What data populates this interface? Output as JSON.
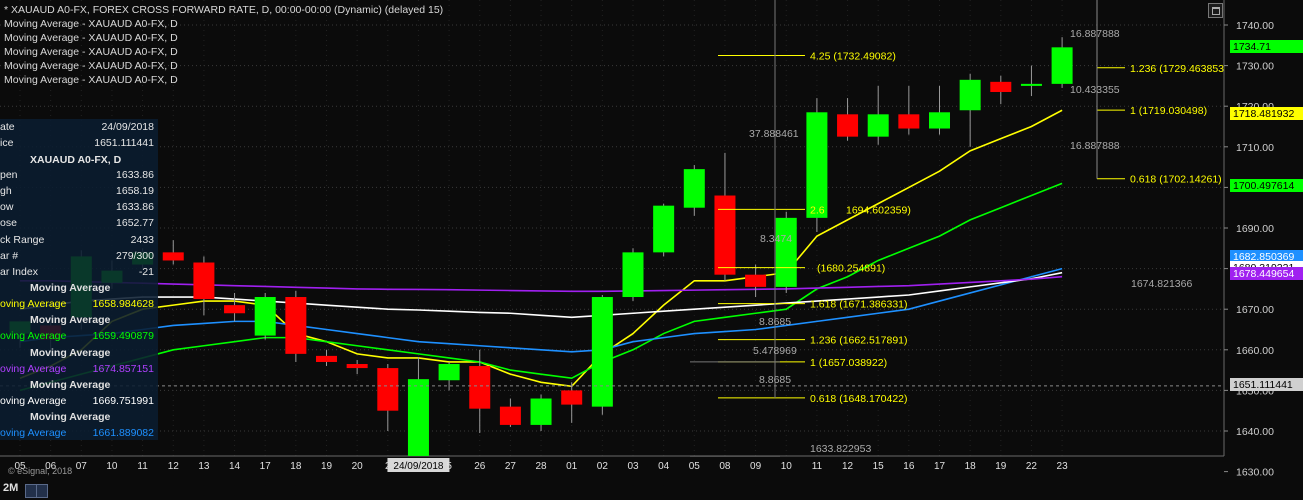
{
  "header": {
    "title": "* XAUAUD A0-FX, FOREX CROSS FORWARD RATE, D, 00:00-00:00 (Dynamic) (delayed 15)",
    "studies": [
      "Moving Average - XAUAUD A0-FX, D",
      "Moving Average - XAUAUD A0-FX, D",
      "Moving Average - XAUAUD A0-FX, D",
      "Moving Average - XAUAUD A0-FX, D",
      "Moving Average - XAUAUD A0-FX, D"
    ]
  },
  "panel": {
    "date_label": "ate",
    "date_value": "24/09/2018",
    "price_label": "ice",
    "price_value": "1651.111441",
    "symbol": "XAUAUD A0-FX, D",
    "open_label": "pen",
    "open_value": "1633.86",
    "high_label": "gh",
    "high_value": "1658.19",
    "low_label": "ow",
    "low_value": "1633.86",
    "close_label": "ose",
    "close_value": "1652.77",
    "tick_label": "ck Range",
    "tick_value": "2433",
    "bar_label": "ar #",
    "bar_value": "279/300",
    "index_label": "ar Index",
    "index_value": "-21",
    "ma": [
      {
        "head": "Moving Average",
        "label": "oving Average",
        "value": "1658.984628",
        "color": "#ffff00"
      },
      {
        "head": "Moving Average",
        "label": "oving Average",
        "value": "1659.490879",
        "color": "#00ff00"
      },
      {
        "head": "Moving Average",
        "label": "oving Average",
        "value": "1674.857151",
        "color": "#a020f0"
      },
      {
        "head": "Moving Average",
        "label": "oving Average",
        "value": "1669.751991",
        "color": "#ffffff"
      },
      {
        "head": "Moving Average",
        "label": "oving Average",
        "value": "1661.889082",
        "color": "#1e90ff"
      }
    ]
  },
  "footer": {
    "copyright": "© eSignal, 2018",
    "timeframe": "2M"
  },
  "colors": {
    "background": "#0b0b0b",
    "up": "#00ff00",
    "down": "#ff0000",
    "fib": "#ffff00",
    "grid": "#3a3a3a"
  },
  "chart_data": {
    "type": "candlestick",
    "ylim": [
      1628,
      1746
    ],
    "yticks": [
      "1740.00",
      "1730.00",
      "1720.00",
      "1710.00",
      "1700.00",
      "1690.00",
      "1680.00",
      "1670.00",
      "1660.00",
      "1650.00",
      "1640.00",
      "1630.00"
    ],
    "x": [
      "05",
      "06",
      "07",
      "10",
      "11",
      "12",
      "13",
      "14",
      "17",
      "18",
      "19",
      "20",
      "21",
      "24/09/2018",
      "25",
      "26",
      "27",
      "28",
      "01",
      "02",
      "03",
      "04",
      "05",
      "08",
      "09",
      "10",
      "11",
      "12",
      "15",
      "16",
      "17",
      "18",
      "19",
      "22",
      "23"
    ],
    "x_tick_labels": [
      "05",
      "06",
      "07",
      "10",
      "11",
      "12",
      "13",
      "14",
      "17",
      "18",
      "19",
      "20",
      "2",
      "24/09/2018",
      "5",
      "26",
      "27",
      "28",
      "01",
      "02",
      "03",
      "04",
      "05",
      "08",
      "09",
      "10",
      "11",
      "12",
      "15",
      "16",
      "17",
      "18",
      "19",
      "22",
      "23"
    ],
    "candles": [
      {
        "o": 1664.0,
        "h": 1666.5,
        "l": 1660.5,
        "c": 1667.0
      },
      {
        "o": 1666.0,
        "h": 1667.5,
        "l": 1658.5,
        "c": 1662.5
      },
      {
        "o": 1668.0,
        "h": 1684.5,
        "l": 1665.0,
        "c": 1683.0
      },
      {
        "o": 1676.5,
        "h": 1682.0,
        "l": 1675.0,
        "c": 1679.5
      },
      {
        "o": 1681.0,
        "h": 1685.0,
        "l": 1680.0,
        "c": 1684.0
      },
      {
        "o": 1684.0,
        "h": 1687.0,
        "l": 1681.0,
        "c": 1682.0
      },
      {
        "o": 1681.5,
        "h": 1683.0,
        "l": 1668.5,
        "c": 1672.5
      },
      {
        "o": 1671.0,
        "h": 1674.0,
        "l": 1667.0,
        "c": 1669.0
      },
      {
        "o": 1663.5,
        "h": 1674.0,
        "l": 1662.5,
        "c": 1673.0
      },
      {
        "o": 1673.0,
        "h": 1674.5,
        "l": 1657.0,
        "c": 1659.0
      },
      {
        "o": 1658.5,
        "h": 1660.0,
        "l": 1656.0,
        "c": 1657.0
      },
      {
        "o": 1656.5,
        "h": 1657.5,
        "l": 1654.0,
        "c": 1655.5
      },
      {
        "o": 1655.5,
        "h": 1656.5,
        "l": 1640.0,
        "c": 1645.0
      },
      {
        "o": 1633.86,
        "h": 1658.19,
        "l": 1633.86,
        "c": 1652.77
      },
      {
        "o": 1652.5,
        "h": 1657.0,
        "l": 1650.0,
        "c": 1656.5
      },
      {
        "o": 1656.0,
        "h": 1660.0,
        "l": 1639.5,
        "c": 1645.5
      },
      {
        "o": 1646.0,
        "h": 1648.0,
        "l": 1641.0,
        "c": 1641.5
      },
      {
        "o": 1641.5,
        "h": 1649.0,
        "l": 1640.0,
        "c": 1648.0
      },
      {
        "o": 1650.0,
        "h": 1652.0,
        "l": 1642.0,
        "c": 1646.5
      },
      {
        "o": 1646.0,
        "h": 1673.5,
        "l": 1644.0,
        "c": 1673.0
      },
      {
        "o": 1673.0,
        "h": 1685.0,
        "l": 1672.0,
        "c": 1684.0
      },
      {
        "o": 1684.0,
        "h": 1696.0,
        "l": 1683.0,
        "c": 1695.5
      },
      {
        "o": 1695.0,
        "h": 1705.5,
        "l": 1693.0,
        "c": 1704.5
      },
      {
        "o": 1698.0,
        "h": 1708.5,
        "l": 1677.0,
        "c": 1678.5
      },
      {
        "o": 1678.5,
        "h": 1681.0,
        "l": 1673.0,
        "c": 1675.5
      },
      {
        "o": 1675.5,
        "h": 1694.0,
        "l": 1674.0,
        "c": 1692.5
      },
      {
        "o": 1692.5,
        "h": 1722.0,
        "l": 1689.0,
        "c": 1718.5
      },
      {
        "o": 1718.0,
        "h": 1722.0,
        "l": 1711.5,
        "c": 1712.5
      },
      {
        "o": 1712.5,
        "h": 1725.0,
        "l": 1710.5,
        "c": 1718.0
      },
      {
        "o": 1718.0,
        "h": 1725.0,
        "l": 1713.0,
        "c": 1714.5
      },
      {
        "o": 1714.5,
        "h": 1725.0,
        "l": 1713.0,
        "c": 1718.5
      },
      {
        "o": 1719.0,
        "h": 1728.0,
        "l": 1710.0,
        "c": 1726.5
      },
      {
        "o": 1726.0,
        "h": 1727.5,
        "l": 1720.5,
        "c": 1723.5
      },
      {
        "o": 1725.0,
        "h": 1730.0,
        "l": 1722.5,
        "c": 1725.5
      },
      {
        "o": 1725.5,
        "h": 1737.0,
        "l": 1724.5,
        "c": 1734.5
      }
    ],
    "moving_averages": [
      {
        "color": "#ffff00",
        "values": [
          1653,
          1656,
          1660,
          1667,
          1670,
          1671,
          1672,
          1672,
          1671,
          1664,
          1662,
          1659,
          1658,
          1658,
          1657,
          1657,
          1654,
          1652,
          1651,
          1659,
          1664,
          1671,
          1677,
          1677,
          1678,
          1679,
          1688,
          1692,
          1696,
          1700,
          1704,
          1709,
          1712,
          1715,
          1719
        ]
      },
      {
        "color": "#00ff00",
        "values": [
          1650,
          1652,
          1654,
          1656,
          1658,
          1660,
          1661,
          1662,
          1663,
          1663,
          1662,
          1661,
          1660,
          1659,
          1658,
          1657,
          1655,
          1654,
          1653,
          1657,
          1660,
          1664,
          1667,
          1668,
          1669,
          1670,
          1675,
          1678,
          1682,
          1685,
          1688,
          1692,
          1695,
          1698,
          1701
        ]
      },
      {
        "color": "#1e90ff",
        "values": [
          1662,
          1663,
          1663.5,
          1664,
          1665,
          1666,
          1666.5,
          1667,
          1667,
          1666,
          1665,
          1664,
          1663,
          1662,
          1661.5,
          1661,
          1660.5,
          1660,
          1659.5,
          1660,
          1662,
          1663,
          1664,
          1664.5,
          1665,
          1666,
          1667,
          1668,
          1669,
          1670,
          1672,
          1674,
          1676,
          1678,
          1680
        ]
      },
      {
        "color": "#ffffff",
        "values": [
          1670,
          1671,
          1672,
          1672.5,
          1673,
          1673,
          1673,
          1672.5,
          1672,
          1671.5,
          1671,
          1670.5,
          1670,
          1669.8,
          1669.5,
          1669.2,
          1669,
          1668.5,
          1668,
          1668.5,
          1669,
          1669.5,
          1670,
          1670.5,
          1671,
          1671.5,
          1672,
          1672.5,
          1673,
          1673.5,
          1674.5,
          1675.5,
          1676.5,
          1677.5,
          1679
        ]
      },
      {
        "color": "#a020f0",
        "values": [
          1677,
          1677,
          1676.8,
          1676.6,
          1676.4,
          1676.2,
          1676,
          1675.8,
          1675.6,
          1675.4,
          1675.2,
          1675,
          1674.9,
          1674.86,
          1674.8,
          1674.7,
          1674.6,
          1674.5,
          1674.4,
          1674.4,
          1674.5,
          1674.6,
          1674.7,
          1674.8,
          1674.9,
          1675,
          1675.2,
          1675.4,
          1675.6,
          1675.8,
          1676.2,
          1676.6,
          1677,
          1677.4,
          1678
        ]
      }
    ],
    "fibonacci": [
      {
        "label": "4.25 (1732.49082)",
        "value": 1732.49082
      },
      {
        "label": "2.618 (1694.602359)",
        "value": 1694.602359
      },
      {
        "label": "1 (1680.254891)",
        "value": 1680.254891
      },
      {
        "label": "1.618 (1671.386331)",
        "value": 1671.386331
      },
      {
        "label": "1.236 (1662.517891)",
        "value": 1662.517891
      },
      {
        "label": "1 (1657.038922)",
        "value": 1657.038922
      },
      {
        "label": "0.618 (1648.170422)",
        "value": 1648.170422
      }
    ],
    "fibonacci_labels": [
      "4.25 (1732.49082)",
      "2.6",
      "1694.602359)",
      "(1680.254891)",
      "1.618 (1671.386331)",
      "1.236 (1662.517891)",
      "1 (1657.038922)",
      "0.618 (1648.170422)"
    ],
    "fib_right": [
      {
        "label": "1.236 (1729.463853",
        "value": 1729.463853
      },
      {
        "label": "1 (1719.030498)",
        "value": 1719.030498
      },
      {
        "label": "0.618 (1702.14261)",
        "value": 1702.14261
      }
    ],
    "measure_labels": [
      "37.888461",
      "8.3474",
      "8.8685",
      "5.478969",
      "8.8685",
      "1633.822953",
      "16.887888",
      "10.433355",
      "16.887888",
      "1674.821366"
    ],
    "price_badges": [
      {
        "label": "1734.71",
        "value": 1734.71,
        "color": "#00ff00"
      },
      {
        "label": "1718.481932",
        "value": 1718.48,
        "color": "#ffff00"
      },
      {
        "label": "1700.497614",
        "value": 1700.5,
        "color": "#00ff00"
      },
      {
        "label": "1682.850369",
        "value": 1682.85,
        "color": "#1e90ff"
      },
      {
        "label": "1680.319221",
        "value": 1680.32,
        "color": "#ffffff"
      },
      {
        "label": "1678.449654",
        "value": 1678.45,
        "color": "#a020f0"
      },
      {
        "label": "1651.111441",
        "value": 1651.11,
        "color": "#d0d0d0"
      }
    ],
    "current_price": 1651.111441
  }
}
